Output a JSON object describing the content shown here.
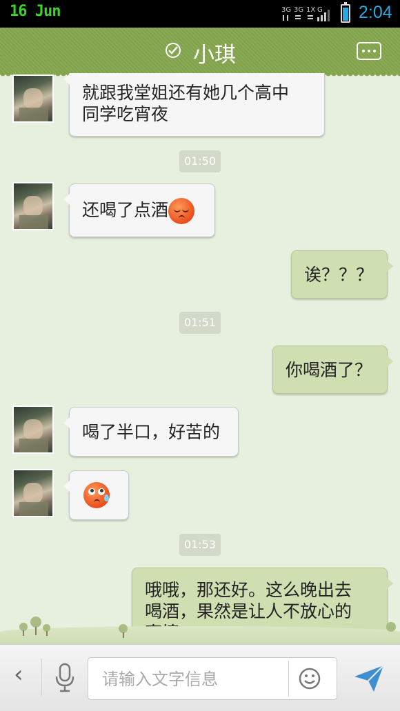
{
  "status_bar": {
    "date": "16 Jun",
    "time": "2:04",
    "network": "3G 3G 1X G"
  },
  "header": {
    "contact_name": "小琪",
    "verified_icon": "check-circle-icon",
    "more_icon": "more-dots-icon"
  },
  "messages": [
    {
      "side": "left",
      "text_lines": [
        "就跟我堂姐还有她几个高中",
        "同学吃宵夜"
      ]
    },
    {
      "type": "time",
      "text": "01:50"
    },
    {
      "side": "left",
      "text": "还喝了点酒",
      "emoji": "sleepy-face-emoji"
    },
    {
      "side": "right",
      "text": "诶？？？"
    },
    {
      "type": "time",
      "text": "01:51"
    },
    {
      "side": "right",
      "text": "你喝酒了？"
    },
    {
      "side": "left",
      "text": "喝了半口，好苦的"
    },
    {
      "side": "left",
      "emoji": "nervous-sweat-emoji"
    },
    {
      "type": "time",
      "text": "01:53"
    },
    {
      "side": "right",
      "text_lines": [
        "哦哦，那还好。这么晚出去",
        "喝酒，果然是让人不放心的",
        "事情。"
      ]
    }
  ],
  "input_bar": {
    "placeholder": "请输入文字信息",
    "back_icon": "chevron-left-icon",
    "mic_icon": "microphone-icon",
    "emoji_icon": "smiley-icon",
    "send_icon": "send-icon"
  },
  "colors": {
    "title_bar": "#86a74e",
    "chat_bg": "#e7efde",
    "outgoing_bubble": "#cfdfb1",
    "incoming_bubble": "#f6f6f6",
    "time_accent": "#2aa7e0"
  }
}
